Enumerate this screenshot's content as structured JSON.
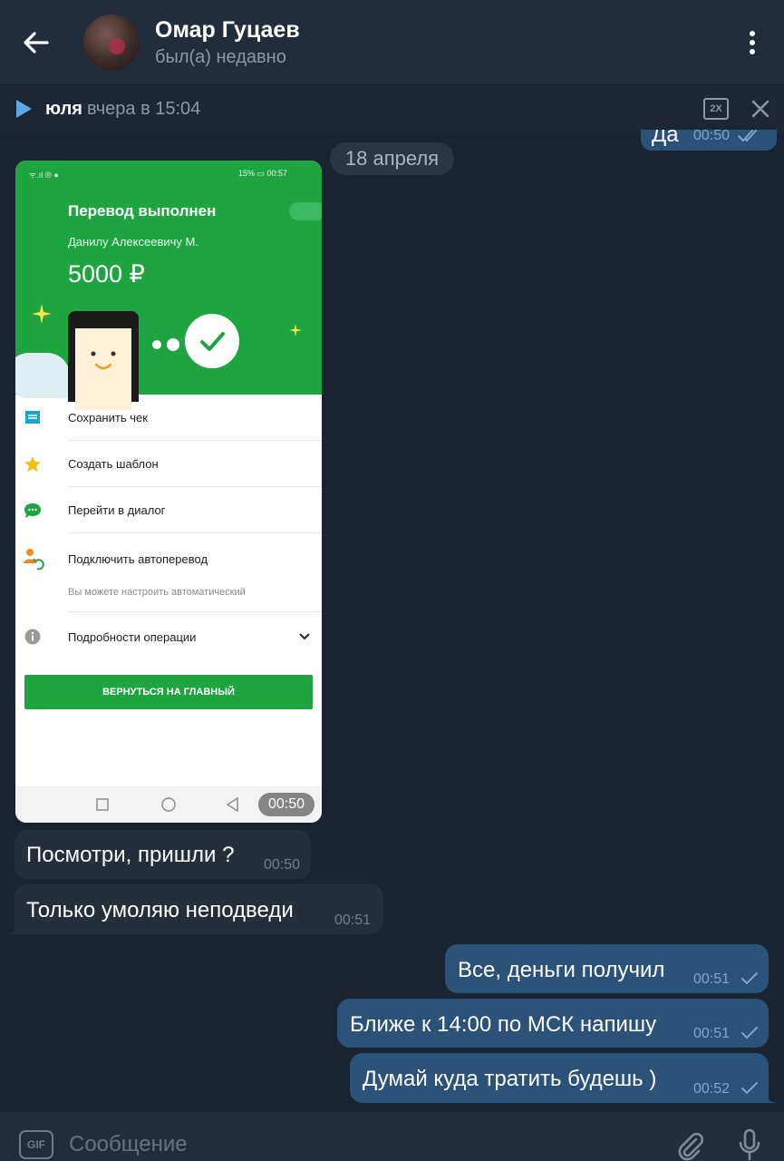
{
  "header": {
    "contact_name": "Омар Гуцаев",
    "status": "был(а) недавно",
    "back_icon": "arrow-left-icon",
    "menu_icon": "more-vertical-icon"
  },
  "player": {
    "sender": "юля",
    "time": "вчера в 15:04",
    "speed_label": "2X"
  },
  "top_message": {
    "text": "Да",
    "time": "00:50"
  },
  "date_badge": "18 апреля",
  "photo": {
    "status_left": "ᯤ.ıl ⦾ ●",
    "status_right": "15% ▭ 00:57",
    "title": "Перевод выполнен",
    "recipient": "Данилу Алексеевичу М.",
    "amount": "5000 ₽",
    "menu": [
      {
        "label": "Сохранить чек",
        "icon": "receipt-icon"
      },
      {
        "label": "Создать шаблон",
        "icon": "star-icon"
      },
      {
        "label": "Перейти в диалог",
        "icon": "chat-icon"
      },
      {
        "label": "Подключить автоперевод",
        "icon": "auto-transfer-icon"
      },
      {
        "label": "Подробности операции",
        "icon": "info-icon"
      }
    ],
    "hint": "Вы можете настроить автоматический",
    "return_button": "ВЕРНУТЬСЯ НА ГЛАВНЫЙ",
    "time": "00:50"
  },
  "messages": [
    {
      "direction": "in",
      "text": "Посмотри, пришли ?",
      "time": "00:50"
    },
    {
      "direction": "in",
      "text": "Только умоляю неподведи",
      "time": "00:51"
    },
    {
      "direction": "out",
      "text": "Все, деньги получил",
      "time": "00:51"
    },
    {
      "direction": "out",
      "text": "Ближе к 14:00 по МСК напишу",
      "time": "00:51"
    },
    {
      "direction": "out",
      "text": "Думай куда тратить будешь )",
      "time": "00:52"
    }
  ],
  "composer": {
    "placeholder": "Сообщение",
    "gif_label": "GIF"
  },
  "colors": {
    "header_bg": "#212d3b",
    "chat_bg": "#1a2430",
    "incoming_bubble": "#252f3c",
    "outgoing_bubble": "#2b5278",
    "accent": "#5ea8e6",
    "sber_green": "#1fa442"
  }
}
